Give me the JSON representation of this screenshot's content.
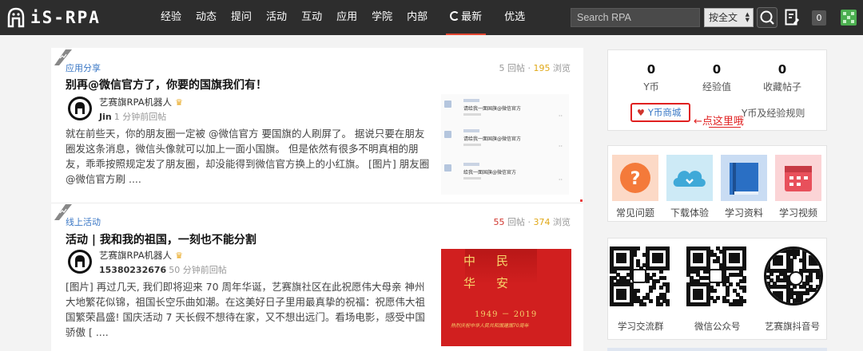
{
  "brand": {
    "name": "iS-RPA"
  },
  "nav": {
    "items": [
      {
        "label": "经验"
      },
      {
        "label": "动态"
      },
      {
        "label": "提问"
      },
      {
        "label": "活动"
      },
      {
        "label": "互动"
      },
      {
        "label": "应用"
      },
      {
        "label": "学院"
      },
      {
        "label": "内部"
      },
      {
        "label": "最新",
        "active": true
      },
      {
        "label": "优选"
      }
    ],
    "search_placeholder": "Search RPA",
    "search_scope": "按全文",
    "notification_count": "0"
  },
  "colors": {
    "accent": "#e2452f",
    "link": "#3a77c5",
    "topbar": "#2d2d2d",
    "hot": "#d0342c",
    "views": "#e0a817"
  },
  "posts": [
    {
      "category": "应用分享",
      "replies": "5",
      "replies_label": "回帖",
      "views": "195",
      "views_label": "浏览",
      "title": "别再@微信官方了，你要的国旗我们有！",
      "author": "艺赛旗RPA机器人",
      "meta_user": "Jin",
      "meta_time": "1 分钟前回帖",
      "excerpt": "就在前些天，你的朋友圈一定被 @微信官方 要国旗的人刷屏了。 据说只要在朋友圈发这条消息，微信头像就可以加上一面小国旗。 但是依然有很多不明真相的朋友，乖乖按照规定发了朋友圈，却没能得到微信官方换上的小红旗。 [图片] 朋友圈@微信官方刷 ....",
      "thumb_messages": [
        "请给我一面国旗@微信官方",
        "请给我一面国旗@微信官方",
        "给我一面国旗@微信官方"
      ]
    },
    {
      "category": "线上活动",
      "replies": "55",
      "replies_label": "回帖",
      "views": "374",
      "views_label": "浏览",
      "title": "活动 | 我和我的祖国，一刻也不能分割",
      "author": "艺赛旗RPA机器人",
      "meta_user": "15380232676",
      "meta_time": "50 分钟前回帖",
      "excerpt": "[图片] 再过几天, 我们即将迎来 70 周年华诞，艺赛旗社区在此祝愿伟大母亲 神州大地繁花似锦，祖国长空乐曲如潮。在这美好日子里用最真挚的祝福：祝愿伟大祖国繁荣昌盛! 国庆活动 7 天长假不想待在家，又不想出远门。看场电影，感受中国骄傲 [ ....",
      "banner_chars": [
        "中",
        "民",
        "华",
        "安"
      ],
      "banner_years": "1949 － 2019",
      "banner_slogan": "热烈庆祝中华人民共和国建国70周年"
    }
  ],
  "user_stats": [
    {
      "value": "0",
      "label": "Y币"
    },
    {
      "value": "0",
      "label": "经验值"
    },
    {
      "value": "0",
      "label": "收藏帖子"
    }
  ],
  "ycoin_mall": "Y币商城",
  "click_hint": "←点这里哦",
  "rules_link": "Y币及经验规则",
  "quick_links": [
    {
      "label": "常见问题",
      "icon": "question-icon",
      "color": "#f47a3a"
    },
    {
      "label": "下载体验",
      "icon": "cloud-download-icon",
      "color": "#3fa9d8"
    },
    {
      "label": "学习资料",
      "icon": "book-icon",
      "color": "#2a6fc4"
    },
    {
      "label": "学习视频",
      "icon": "calendar-video-icon",
      "color": "#e8505b"
    }
  ],
  "qr_codes": [
    {
      "label": "学习交流群"
    },
    {
      "label": "微信公众号"
    },
    {
      "label": "艺赛旗抖音号"
    }
  ]
}
